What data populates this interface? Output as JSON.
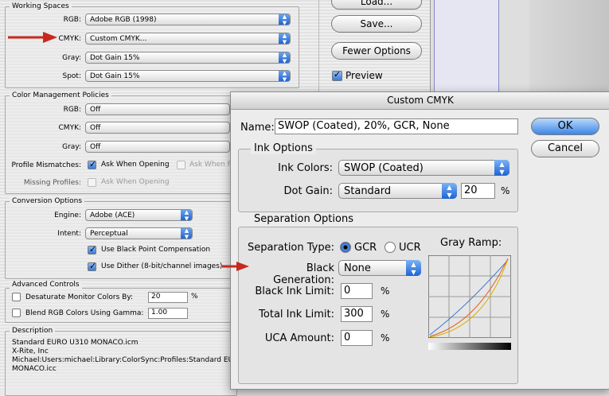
{
  "working_spaces": {
    "title": "Working Spaces",
    "rgb_label": "RGB:",
    "rgb_value": "Adobe RGB (1998)",
    "cmyk_label": "CMYK:",
    "cmyk_value": "Custom CMYK...",
    "gray_label": "Gray:",
    "gray_value": "Dot Gain 15%",
    "spot_label": "Spot:",
    "spot_value": "Dot Gain 15%"
  },
  "right_buttons": {
    "load": "Load...",
    "save": "Save...",
    "fewer": "Fewer Options",
    "preview_label": "Preview",
    "preview_checked": true
  },
  "policies": {
    "title": "Color Management Policies",
    "rgb_label": "RGB:",
    "rgb_value": "Off",
    "cmyk_label": "CMYK:",
    "cmyk_value": "Off",
    "gray_label": "Gray:",
    "gray_value": "Off",
    "mismatch_label": "Profile Mismatches:",
    "ask_opening": "Ask When Opening",
    "ask_pasting": "Ask When P",
    "missing_label": "Missing Profiles:",
    "missing_ask": "Ask When Opening"
  },
  "conversion": {
    "title": "Conversion Options",
    "engine_label": "Engine:",
    "engine_value": "Adobe (ACE)",
    "intent_label": "Intent:",
    "intent_value": "Perceptual",
    "bpc": "Use Black Point Compensation",
    "dither": "Use Dither (8-bit/channel images)"
  },
  "advanced": {
    "title": "Advanced Controls",
    "desaturate": "Desaturate Monitor Colors By:",
    "desaturate_value": "20",
    "desaturate_unit": "%",
    "blend": "Blend RGB Colors Using Gamma:",
    "blend_value": "1.00"
  },
  "description": {
    "title": "Description",
    "line1": "Standard EURO U310 MONACO.icm",
    "line2": "X-Rite, Inc",
    "line3": "Michael:Users:michael:Library:ColorSync:Profiles:Standard EURO",
    "line4": "MONACO.icc"
  },
  "dialog": {
    "title": "Custom CMYK",
    "name_label": "Name:",
    "name_value": "SWOP (Coated), 20%, GCR, None",
    "ok": "OK",
    "cancel": "Cancel",
    "ink_title": "Ink Options",
    "ink_colors_label": "Ink Colors:",
    "ink_colors_value": "SWOP (Coated)",
    "dot_gain_label": "Dot Gain:",
    "dot_gain_value": "Standard",
    "dot_gain_amount": "20",
    "dot_gain_unit": "%",
    "sep_title": "Separation Options",
    "sep_type_label": "Separation Type:",
    "gcr": "GCR",
    "ucr": "UCR",
    "selected_type": "GCR",
    "gray_ramp": "Gray Ramp:",
    "black_gen_label": "Black Generation:",
    "black_gen_value": "None",
    "black_limit_label": "Black Ink Limit:",
    "black_limit_value": "0",
    "black_limit_unit": "%",
    "total_limit_label": "Total Ink Limit:",
    "total_limit_value": "300",
    "total_limit_unit": "%",
    "uca_label": "UCA Amount:",
    "uca_value": "0",
    "uca_unit": "%"
  },
  "colors": {
    "annotation_arrow": "#c8281e",
    "aqua_blue": "#1e63d2"
  }
}
